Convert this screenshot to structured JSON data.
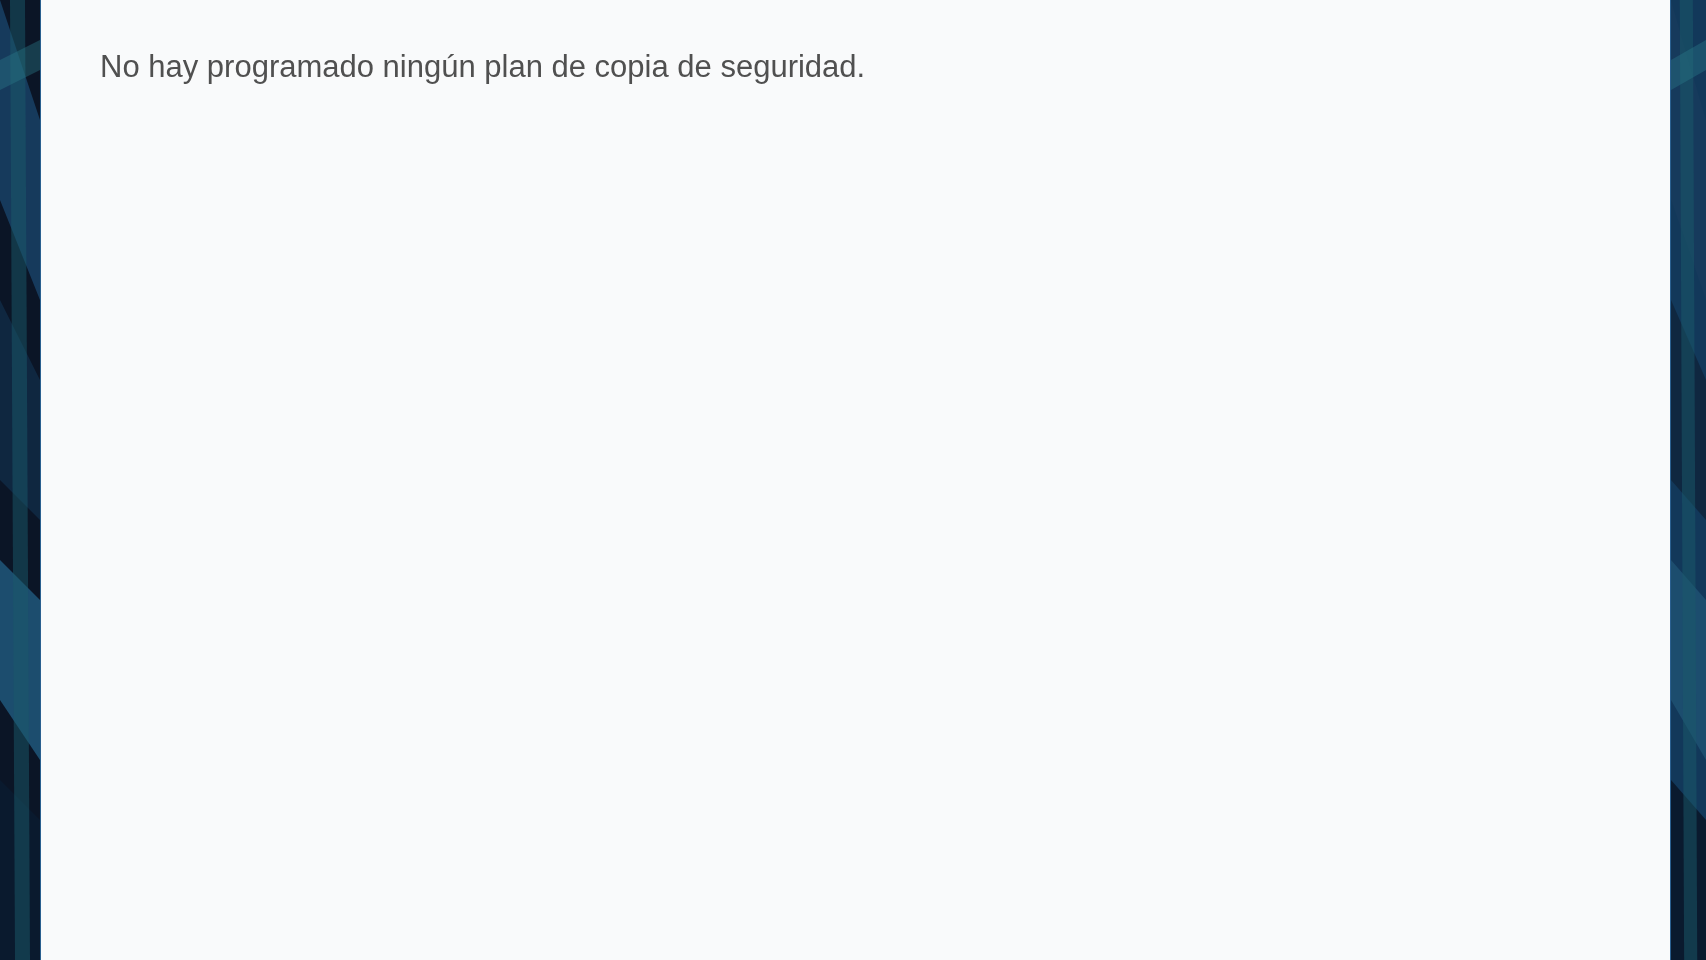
{
  "panel": {
    "message": "No hay programado ningún plan de copia de seguridad."
  }
}
